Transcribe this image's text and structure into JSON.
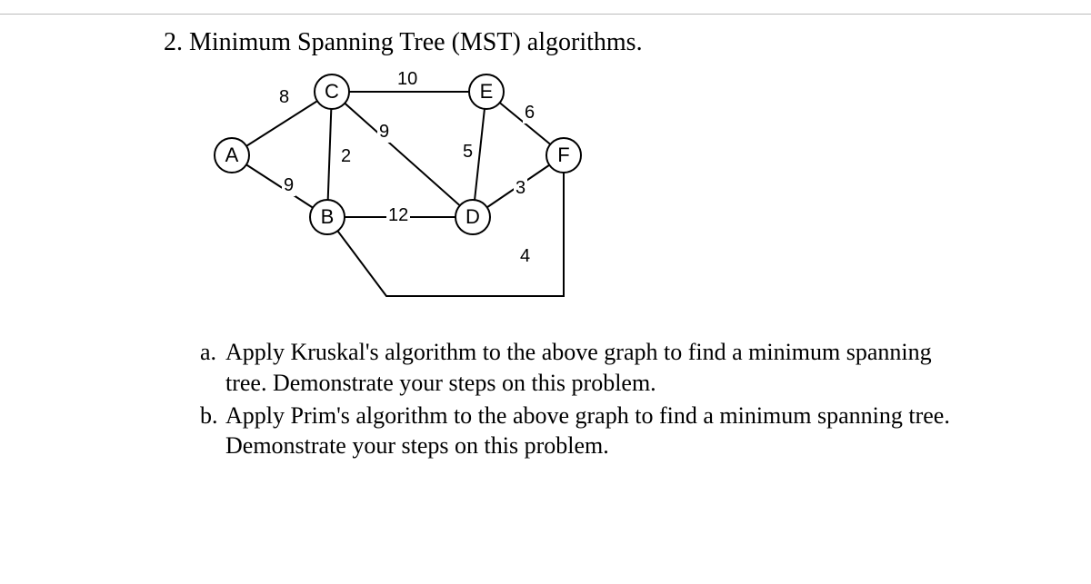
{
  "question_number": "2.",
  "question_title": "Minimum Spanning Tree (MST) algorithms.",
  "graph": {
    "nodes": {
      "A": "A",
      "B": "B",
      "C": "C",
      "D": "D",
      "E": "E",
      "F": "F"
    },
    "edge_weights": {
      "AC": "8",
      "CE": "10",
      "CD_left": "9",
      "CB": "2",
      "AB": "9",
      "ED": "5",
      "EF": "6",
      "DF": "3",
      "BD": "12",
      "BF": "4"
    }
  },
  "sub_a_letter": "a.",
  "sub_a_text": "Apply Kruskal's algorithm to the above graph to find a minimum spanning tree. Demonstrate your steps on this problem.",
  "sub_b_letter": "b.",
  "sub_b_text": "Apply Prim's algorithm to the above graph to find a minimum spanning tree. Demonstrate your steps on this problem."
}
